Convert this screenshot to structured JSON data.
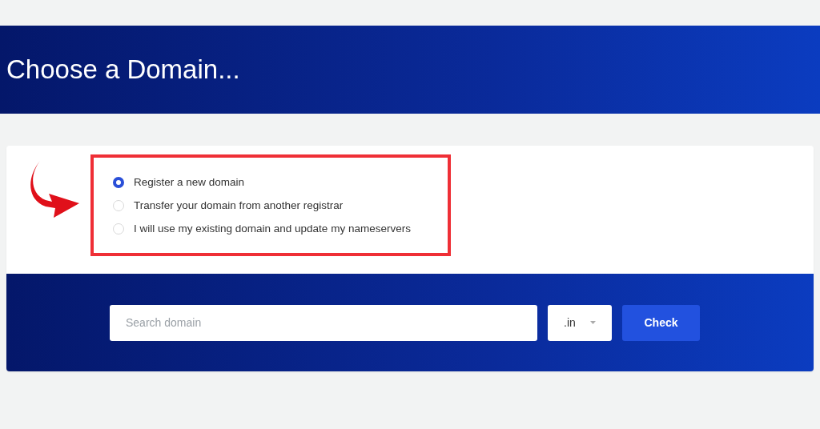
{
  "header": {
    "title": "Choose a Domain..."
  },
  "options": [
    {
      "label": "Register a new domain",
      "selected": true
    },
    {
      "label": "Transfer your domain from another registrar",
      "selected": false
    },
    {
      "label": "I will use my existing domain and update my nameservers",
      "selected": false
    }
  ],
  "search": {
    "placeholder": "Search domain",
    "tld": ".in",
    "button": "Check"
  }
}
